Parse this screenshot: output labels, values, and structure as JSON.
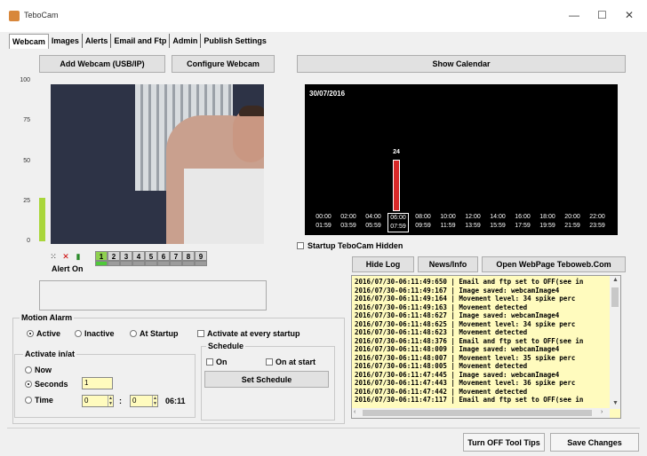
{
  "window": {
    "title": "TeboCam",
    "minimize": "—",
    "maximize": "☐",
    "close": "✕"
  },
  "tabs": [
    "Webcam",
    "Images",
    "Alerts",
    "Email and Ftp",
    "Admin",
    "Publish Settings"
  ],
  "buttons": {
    "add_webcam": "Add Webcam (USB/IP)",
    "configure_webcam": "Configure Webcam",
    "show_calendar": "Show Calendar",
    "hide_log": "Hide Log",
    "news_info": "News/Info",
    "open_webpage": "Open WebPage Teboweb.Com",
    "set_schedule": "Set Schedule",
    "turn_off_tooltips": "Turn OFF Tool Tips",
    "save_changes": "Save Changes"
  },
  "level_meter": {
    "ticks": [
      "100",
      "75",
      "50",
      "25",
      "0"
    ],
    "level_percent": 27
  },
  "alert": {
    "label": "Alert On",
    "icons": [
      "move-arrows-icon",
      "no-alarm-icon",
      "trafficlight-icon"
    ],
    "cameras": [
      "1",
      "2",
      "3",
      "4",
      "5",
      "6",
      "7",
      "8",
      "9"
    ],
    "active_camera": "1"
  },
  "startup_hidden": {
    "label": "Startup TeboCam Hidden",
    "checked": false
  },
  "motion_alarm": {
    "title": "Motion Alarm",
    "options": [
      "Active",
      "Inactive",
      "At Startup"
    ],
    "selected": "Active",
    "activate_every_startup": "Activate at every startup"
  },
  "activate_in_at": {
    "title": "Activate in/at",
    "now": "Now",
    "seconds": "Seconds",
    "seconds_value": "1",
    "time": "Time",
    "selected": "Seconds",
    "hour_value": "0",
    "minute_value": "0",
    "colon": ":",
    "current_time": "06:11"
  },
  "schedule": {
    "title": "Schedule",
    "on": "On",
    "on_at_start": "On at start"
  },
  "calendar": {
    "date": "30/07/2016",
    "bar_count": "24",
    "bar_hour_index": 3,
    "hours": [
      [
        "00:00",
        "01:59"
      ],
      [
        "02:00",
        "03:59"
      ],
      [
        "04:00",
        "05:59"
      ],
      [
        "06:00",
        "07:59"
      ],
      [
        "08:00",
        "09:59"
      ],
      [
        "10:00",
        "11:59"
      ],
      [
        "12:00",
        "13:59"
      ],
      [
        "14:00",
        "15:59"
      ],
      [
        "16:00",
        "17:59"
      ],
      [
        "18:00",
        "19:59"
      ],
      [
        "20:00",
        "21:59"
      ],
      [
        "22:00",
        "23:59"
      ]
    ]
  },
  "log": [
    "2016/07/30-06:11:49:650 | Email and ftp set to OFF(see in",
    "2016/07/30-06:11:49:167 | Image saved: webcamImage4",
    "2016/07/30-06:11:49:164 | Movement level: 34 spike perc",
    "2016/07/30-06:11:49:163 | Movement detected",
    "2016/07/30-06:11:48:627 | Image saved: webcamImage4",
    "2016/07/30-06:11:48:625 | Movement level: 34 spike perc",
    "2016/07/30-06:11:48:623 | Movement detected",
    "2016/07/30-06:11:48:376 | Email and ftp set to OFF(see in",
    "2016/07/30-06:11:48:009 | Image saved: webcamImage4",
    "2016/07/30-06:11:48:007 | Movement level: 35 spike perc",
    "2016/07/30-06:11:48:005 | Movement detected",
    "2016/07/30-06:11:47:445 | Image saved: webcamImage4",
    "2016/07/30-06:11:47:443 | Movement level: 36 spike perc",
    "2016/07/30-06:11:47:442 | Movement detected",
    "2016/07/30-06:11:47:117 | Email and ftp set to OFF(see in"
  ],
  "colors": {
    "log_bg": "#fffbbe",
    "level_green": "#a9d63b",
    "bar_red": "#d62828",
    "camera_on": "#8fd14f"
  }
}
